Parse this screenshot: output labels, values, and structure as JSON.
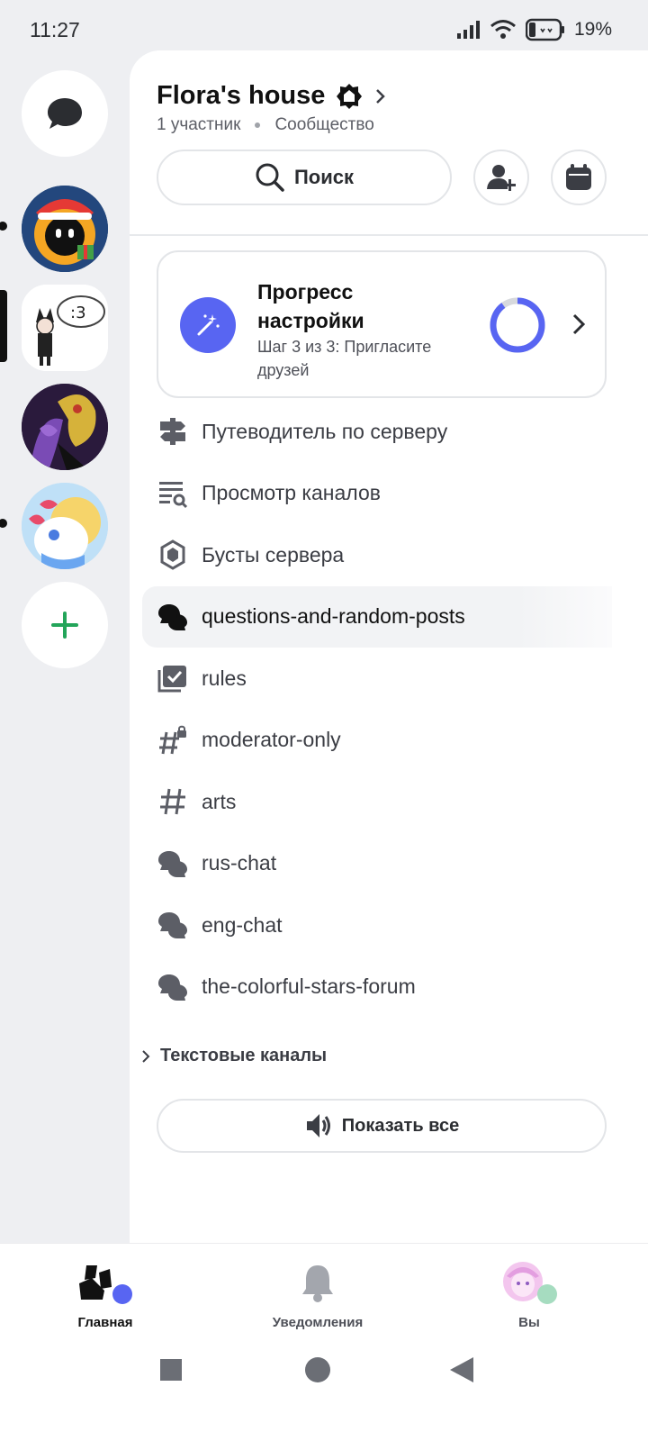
{
  "status_bar": {
    "time": "11:27",
    "battery": "19%"
  },
  "server": {
    "name": "Flora's house",
    "members": "1 участник",
    "type": "Сообщество"
  },
  "search": {
    "label": "Поиск"
  },
  "progress": {
    "title": "Прогресс настройки",
    "subtitle": "Шаг 3 из 3: Пригласите друзей",
    "fraction": 0.9
  },
  "nav_items": [
    {
      "label": "Путеводитель по серверу",
      "icon": "signpost-icon"
    },
    {
      "label": "Просмотр каналов",
      "icon": "browse-channels-icon"
    },
    {
      "label": "Бусты сервера",
      "icon": "boost-icon"
    },
    {
      "label": "questions-and-random-posts",
      "icon": "forum-icon"
    },
    {
      "label": "rules",
      "icon": "rules-icon"
    },
    {
      "label": "moderator-only",
      "icon": "locked-hash-icon"
    },
    {
      "label": "arts",
      "icon": "hash-icon"
    },
    {
      "label": "rus-chat",
      "icon": "forum-icon"
    },
    {
      "label": "eng-chat",
      "icon": "forum-icon"
    },
    {
      "label": "the-colorful-stars-forum",
      "icon": "forum-icon"
    }
  ],
  "category": {
    "label": "Текстовые каналы"
  },
  "show_all": {
    "label": "Показать все"
  },
  "tabs": {
    "home": "Главная",
    "notifications": "Уведомления",
    "you": "Вы"
  },
  "colors": {
    "accent": "#5865f2",
    "add_green": "#23a55a"
  }
}
